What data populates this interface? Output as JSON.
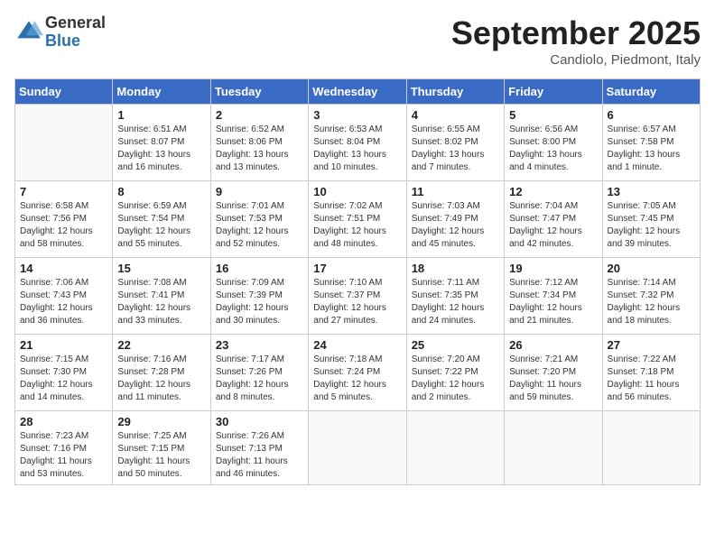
{
  "header": {
    "logo_general": "General",
    "logo_blue": "Blue",
    "month": "September 2025",
    "location": "Candiolo, Piedmont, Italy"
  },
  "days_of_week": [
    "Sunday",
    "Monday",
    "Tuesday",
    "Wednesday",
    "Thursday",
    "Friday",
    "Saturday"
  ],
  "weeks": [
    [
      {
        "day": "",
        "info": ""
      },
      {
        "day": "1",
        "info": "Sunrise: 6:51 AM\nSunset: 8:07 PM\nDaylight: 13 hours\nand 16 minutes."
      },
      {
        "day": "2",
        "info": "Sunrise: 6:52 AM\nSunset: 8:06 PM\nDaylight: 13 hours\nand 13 minutes."
      },
      {
        "day": "3",
        "info": "Sunrise: 6:53 AM\nSunset: 8:04 PM\nDaylight: 13 hours\nand 10 minutes."
      },
      {
        "day": "4",
        "info": "Sunrise: 6:55 AM\nSunset: 8:02 PM\nDaylight: 13 hours\nand 7 minutes."
      },
      {
        "day": "5",
        "info": "Sunrise: 6:56 AM\nSunset: 8:00 PM\nDaylight: 13 hours\nand 4 minutes."
      },
      {
        "day": "6",
        "info": "Sunrise: 6:57 AM\nSunset: 7:58 PM\nDaylight: 13 hours\nand 1 minute."
      }
    ],
    [
      {
        "day": "7",
        "info": "Sunrise: 6:58 AM\nSunset: 7:56 PM\nDaylight: 12 hours\nand 58 minutes."
      },
      {
        "day": "8",
        "info": "Sunrise: 6:59 AM\nSunset: 7:54 PM\nDaylight: 12 hours\nand 55 minutes."
      },
      {
        "day": "9",
        "info": "Sunrise: 7:01 AM\nSunset: 7:53 PM\nDaylight: 12 hours\nand 52 minutes."
      },
      {
        "day": "10",
        "info": "Sunrise: 7:02 AM\nSunset: 7:51 PM\nDaylight: 12 hours\nand 48 minutes."
      },
      {
        "day": "11",
        "info": "Sunrise: 7:03 AM\nSunset: 7:49 PM\nDaylight: 12 hours\nand 45 minutes."
      },
      {
        "day": "12",
        "info": "Sunrise: 7:04 AM\nSunset: 7:47 PM\nDaylight: 12 hours\nand 42 minutes."
      },
      {
        "day": "13",
        "info": "Sunrise: 7:05 AM\nSunset: 7:45 PM\nDaylight: 12 hours\nand 39 minutes."
      }
    ],
    [
      {
        "day": "14",
        "info": "Sunrise: 7:06 AM\nSunset: 7:43 PM\nDaylight: 12 hours\nand 36 minutes."
      },
      {
        "day": "15",
        "info": "Sunrise: 7:08 AM\nSunset: 7:41 PM\nDaylight: 12 hours\nand 33 minutes."
      },
      {
        "day": "16",
        "info": "Sunrise: 7:09 AM\nSunset: 7:39 PM\nDaylight: 12 hours\nand 30 minutes."
      },
      {
        "day": "17",
        "info": "Sunrise: 7:10 AM\nSunset: 7:37 PM\nDaylight: 12 hours\nand 27 minutes."
      },
      {
        "day": "18",
        "info": "Sunrise: 7:11 AM\nSunset: 7:35 PM\nDaylight: 12 hours\nand 24 minutes."
      },
      {
        "day": "19",
        "info": "Sunrise: 7:12 AM\nSunset: 7:34 PM\nDaylight: 12 hours\nand 21 minutes."
      },
      {
        "day": "20",
        "info": "Sunrise: 7:14 AM\nSunset: 7:32 PM\nDaylight: 12 hours\nand 18 minutes."
      }
    ],
    [
      {
        "day": "21",
        "info": "Sunrise: 7:15 AM\nSunset: 7:30 PM\nDaylight: 12 hours\nand 14 minutes."
      },
      {
        "day": "22",
        "info": "Sunrise: 7:16 AM\nSunset: 7:28 PM\nDaylight: 12 hours\nand 11 minutes."
      },
      {
        "day": "23",
        "info": "Sunrise: 7:17 AM\nSunset: 7:26 PM\nDaylight: 12 hours\nand 8 minutes."
      },
      {
        "day": "24",
        "info": "Sunrise: 7:18 AM\nSunset: 7:24 PM\nDaylight: 12 hours\nand 5 minutes."
      },
      {
        "day": "25",
        "info": "Sunrise: 7:20 AM\nSunset: 7:22 PM\nDaylight: 12 hours\nand 2 minutes."
      },
      {
        "day": "26",
        "info": "Sunrise: 7:21 AM\nSunset: 7:20 PM\nDaylight: 11 hours\nand 59 minutes."
      },
      {
        "day": "27",
        "info": "Sunrise: 7:22 AM\nSunset: 7:18 PM\nDaylight: 11 hours\nand 56 minutes."
      }
    ],
    [
      {
        "day": "28",
        "info": "Sunrise: 7:23 AM\nSunset: 7:16 PM\nDaylight: 11 hours\nand 53 minutes."
      },
      {
        "day": "29",
        "info": "Sunrise: 7:25 AM\nSunset: 7:15 PM\nDaylight: 11 hours\nand 50 minutes."
      },
      {
        "day": "30",
        "info": "Sunrise: 7:26 AM\nSunset: 7:13 PM\nDaylight: 11 hours\nand 46 minutes."
      },
      {
        "day": "",
        "info": ""
      },
      {
        "day": "",
        "info": ""
      },
      {
        "day": "",
        "info": ""
      },
      {
        "day": "",
        "info": ""
      }
    ]
  ]
}
